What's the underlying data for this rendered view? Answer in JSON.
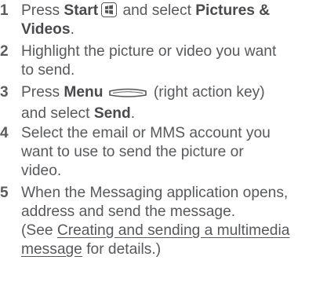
{
  "steps": [
    {
      "number": "1",
      "line1": {
        "pre": "Press ",
        "bold1": "Start",
        "mid": " and select ",
        "bold2": "Pictures &"
      },
      "line2": {
        "bold": "Videos",
        "post": "."
      }
    },
    {
      "number": "2",
      "line1": "Highlight the picture or video you want",
      "line2": "to send."
    },
    {
      "number": "3",
      "line1": {
        "pre": "Press ",
        "bold": "Menu",
        "post": " (right action key)"
      },
      "line2": {
        "pre": "and select ",
        "bold": "Send",
        "post": "."
      }
    },
    {
      "number": "4",
      "line1": "Select the email or MMS account you",
      "line2": "want to use to send the picture or",
      "line3": "video."
    },
    {
      "number": "5",
      "line1": "When the Messaging application opens,",
      "line2": "address and send the message.",
      "line3": {
        "pre": "(See ",
        "link": "Creating and sending a multimedia"
      },
      "line4": {
        "link": "message",
        "post": " for details.)"
      }
    }
  ],
  "icons": {
    "start": "windows-start-key-icon",
    "menu": "right-action-key-icon"
  }
}
